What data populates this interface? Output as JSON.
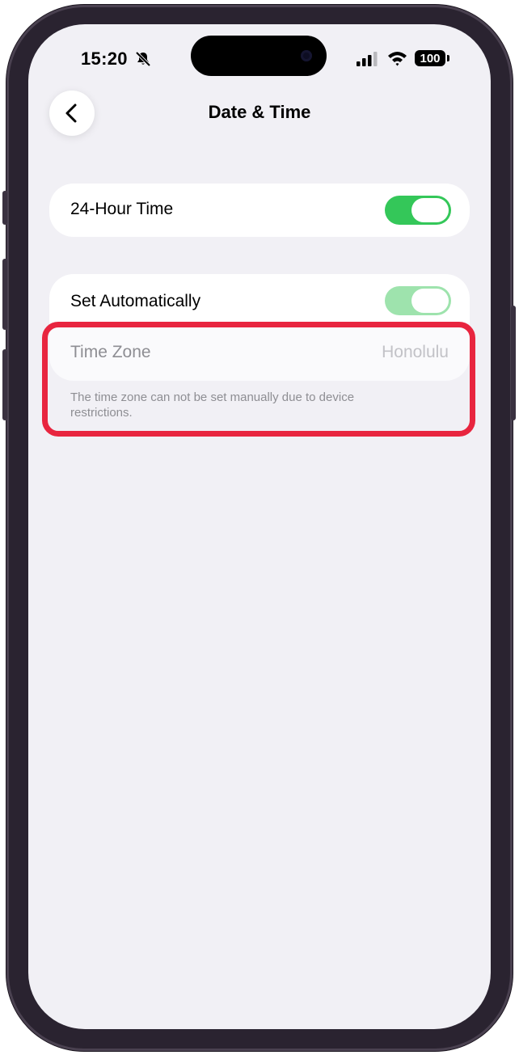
{
  "status_bar": {
    "time": "15:20",
    "icons": [
      "bell-slash-icon",
      "signal-icon",
      "wifi-icon"
    ],
    "battery": "100"
  },
  "nav": {
    "back_icon": "chevron-left-icon",
    "title": "Date & Time"
  },
  "settings": {
    "hour24": {
      "label": "24-Hour Time",
      "enabled": true
    },
    "set_automatically": {
      "label": "Set Automatically",
      "enabled": true,
      "disabled_state": true
    },
    "time_zone": {
      "label": "Time Zone",
      "value": "Honolulu"
    },
    "footnote": "The time zone can not be set manually due to device restrictions."
  },
  "colors": {
    "toggle_on": "#34c759",
    "toggle_on_disabled": "#9ee3ad",
    "highlight": "#e8253f",
    "background": "#f1f0f5"
  }
}
